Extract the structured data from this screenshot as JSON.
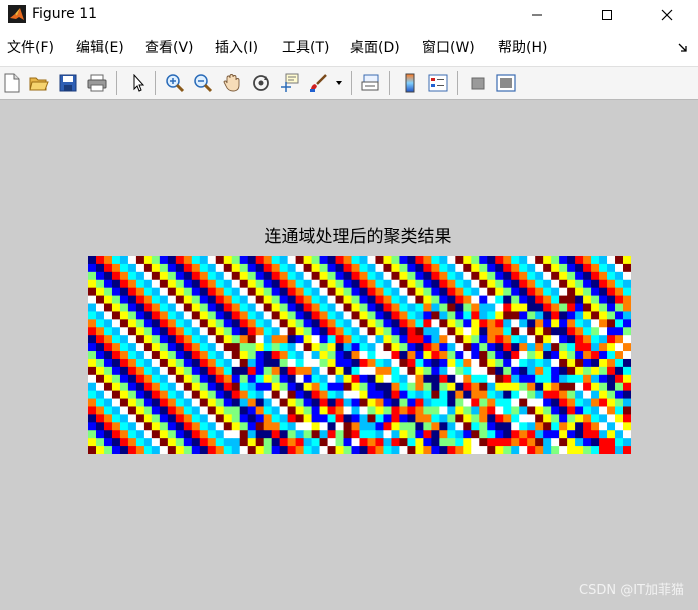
{
  "window": {
    "title": "Figure 11",
    "controls": {
      "minimize": "minimize",
      "maximize": "maximize",
      "close": "close"
    }
  },
  "menubar": {
    "items": [
      {
        "label": "文件(F)"
      },
      {
        "label": "编辑(E)"
      },
      {
        "label": "查看(V)"
      },
      {
        "label": "插入(I)"
      },
      {
        "label": "工具(T)"
      },
      {
        "label": "桌面(D)"
      },
      {
        "label": "窗口(W)"
      },
      {
        "label": "帮助(H)"
      }
    ],
    "overflow_icon": "dock-arrow-icon"
  },
  "toolbar": {
    "buttons": [
      "new-figure-icon",
      "open-file-icon",
      "save-icon",
      "print-icon",
      "pointer-icon",
      "zoom-in-icon",
      "zoom-out-icon",
      "pan-icon",
      "rotate-3d-icon",
      "data-cursor-icon",
      "brush-icon",
      "brush-dropdown-icon",
      "link-plot-icon",
      "colorbar-icon",
      "legend-icon",
      "hide-plot-tools-icon",
      "show-plot-tools-icon"
    ]
  },
  "figure": {
    "title": "连通域处理后的聚类结果",
    "palette": [
      "#00007f",
      "#0000ff",
      "#00bfff",
      "#00ffff",
      "#7fff7f",
      "#ffff00",
      "#ff7f00",
      "#ff0000",
      "#7f0000",
      "#ffffff"
    ],
    "grid": {
      "cols": 68,
      "rows": 25
    }
  },
  "watermark": {
    "text": "CSDN @IT加菲猫"
  },
  "colors": {
    "figure_background": "#cccccc",
    "menubar_background": "#ffffff",
    "toolbar_background": "#f5f5f5"
  }
}
